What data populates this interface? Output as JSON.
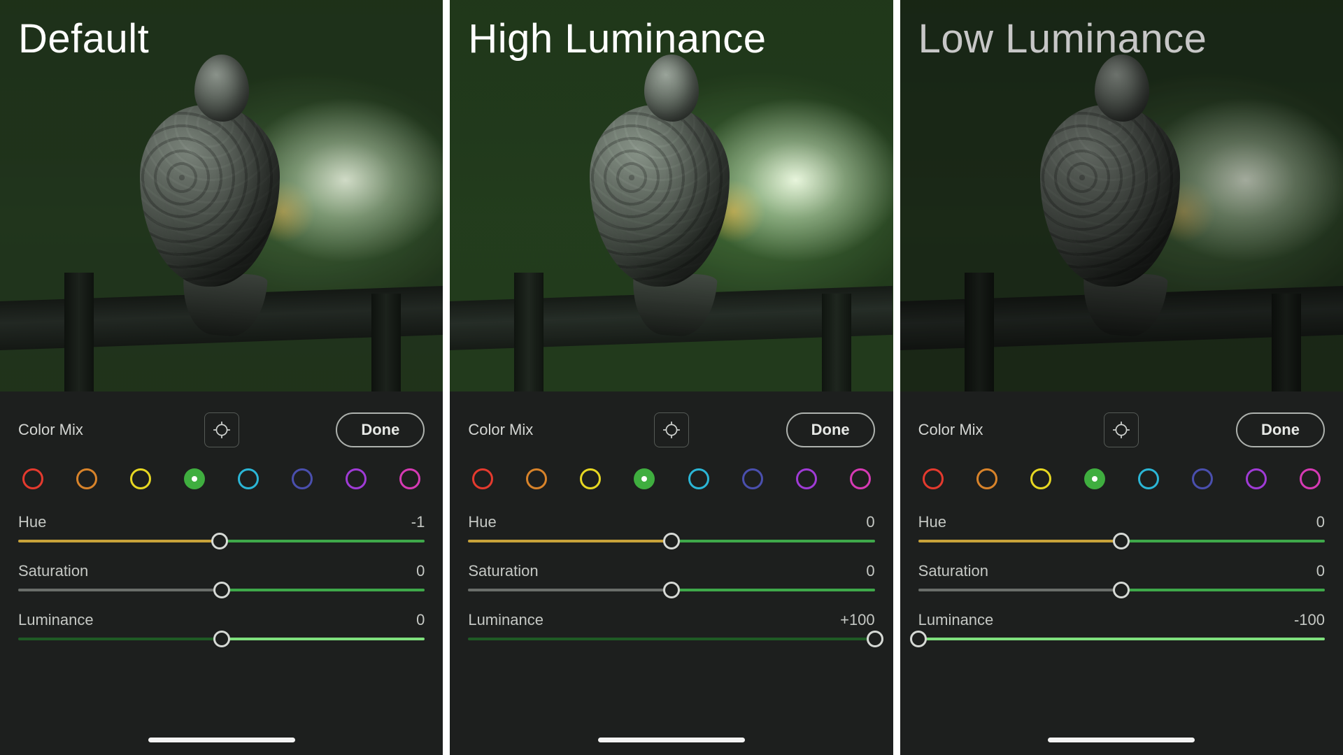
{
  "panels": [
    {
      "caption": "Default",
      "photoVariant": "normal",
      "title": "Color Mix",
      "done": "Done",
      "swatches": [
        {
          "name": "red",
          "color": "#e53a2e",
          "selected": false
        },
        {
          "name": "orange",
          "color": "#d8832a",
          "selected": false
        },
        {
          "name": "yellow",
          "color": "#e7d722",
          "selected": false
        },
        {
          "name": "green",
          "color": "#3fae3f",
          "selected": true
        },
        {
          "name": "aqua",
          "color": "#2bb6d6",
          "selected": false
        },
        {
          "name": "blue",
          "color": "#4a4fae",
          "selected": false
        },
        {
          "name": "purple",
          "color": "#a03bd6",
          "selected": false
        },
        {
          "name": "magenta",
          "color": "#d63ab4",
          "selected": false
        }
      ],
      "sliders": {
        "hue": {
          "label": "Hue",
          "value": "-1",
          "pos": 49.5,
          "leftColor": "#c7a23a",
          "rightColor": "#3ea84a"
        },
        "saturation": {
          "label": "Saturation",
          "value": "0",
          "pos": 50,
          "leftColor": "#6a6e6a",
          "rightColor": "#3ea84a"
        },
        "luminance": {
          "label": "Luminance",
          "value": "0",
          "pos": 50,
          "leftColor": "#1f5a25",
          "rightColor": "#7fe07d"
        }
      }
    },
    {
      "caption": "High Luminance",
      "photoVariant": "bright",
      "title": "Color Mix",
      "done": "Done",
      "swatches": [
        {
          "name": "red",
          "color": "#e53a2e",
          "selected": false
        },
        {
          "name": "orange",
          "color": "#d8832a",
          "selected": false
        },
        {
          "name": "yellow",
          "color": "#e7d722",
          "selected": false
        },
        {
          "name": "green",
          "color": "#3fae3f",
          "selected": true
        },
        {
          "name": "aqua",
          "color": "#2bb6d6",
          "selected": false
        },
        {
          "name": "blue",
          "color": "#4a4fae",
          "selected": false
        },
        {
          "name": "purple",
          "color": "#a03bd6",
          "selected": false
        },
        {
          "name": "magenta",
          "color": "#d63ab4",
          "selected": false
        }
      ],
      "sliders": {
        "hue": {
          "label": "Hue",
          "value": "0",
          "pos": 50,
          "leftColor": "#c7a23a",
          "rightColor": "#3ea84a"
        },
        "saturation": {
          "label": "Saturation",
          "value": "0",
          "pos": 50,
          "leftColor": "#6a6e6a",
          "rightColor": "#3ea84a"
        },
        "luminance": {
          "label": "Luminance",
          "value": "+100",
          "pos": 100,
          "leftColor": "#1f5a25",
          "rightColor": "#b4b7b3"
        }
      }
    },
    {
      "caption": "Low Luminance",
      "photoVariant": "dark",
      "title": "Color Mix",
      "done": "Done",
      "swatches": [
        {
          "name": "red",
          "color": "#e53a2e",
          "selected": false
        },
        {
          "name": "orange",
          "color": "#d8832a",
          "selected": false
        },
        {
          "name": "yellow",
          "color": "#e7d722",
          "selected": false
        },
        {
          "name": "green",
          "color": "#3fae3f",
          "selected": true
        },
        {
          "name": "aqua",
          "color": "#2bb6d6",
          "selected": false
        },
        {
          "name": "blue",
          "color": "#4a4fae",
          "selected": false
        },
        {
          "name": "purple",
          "color": "#a03bd6",
          "selected": false
        },
        {
          "name": "magenta",
          "color": "#d63ab4",
          "selected": false
        }
      ],
      "sliders": {
        "hue": {
          "label": "Hue",
          "value": "0",
          "pos": 50,
          "leftColor": "#c7a23a",
          "rightColor": "#3ea84a"
        },
        "saturation": {
          "label": "Saturation",
          "value": "0",
          "pos": 50,
          "leftColor": "#6a6e6a",
          "rightColor": "#3ea84a"
        },
        "luminance": {
          "label": "Luminance",
          "value": "-100",
          "pos": 0,
          "leftColor": "#b4b7b3",
          "rightColor": "#7fe07d"
        }
      }
    }
  ]
}
